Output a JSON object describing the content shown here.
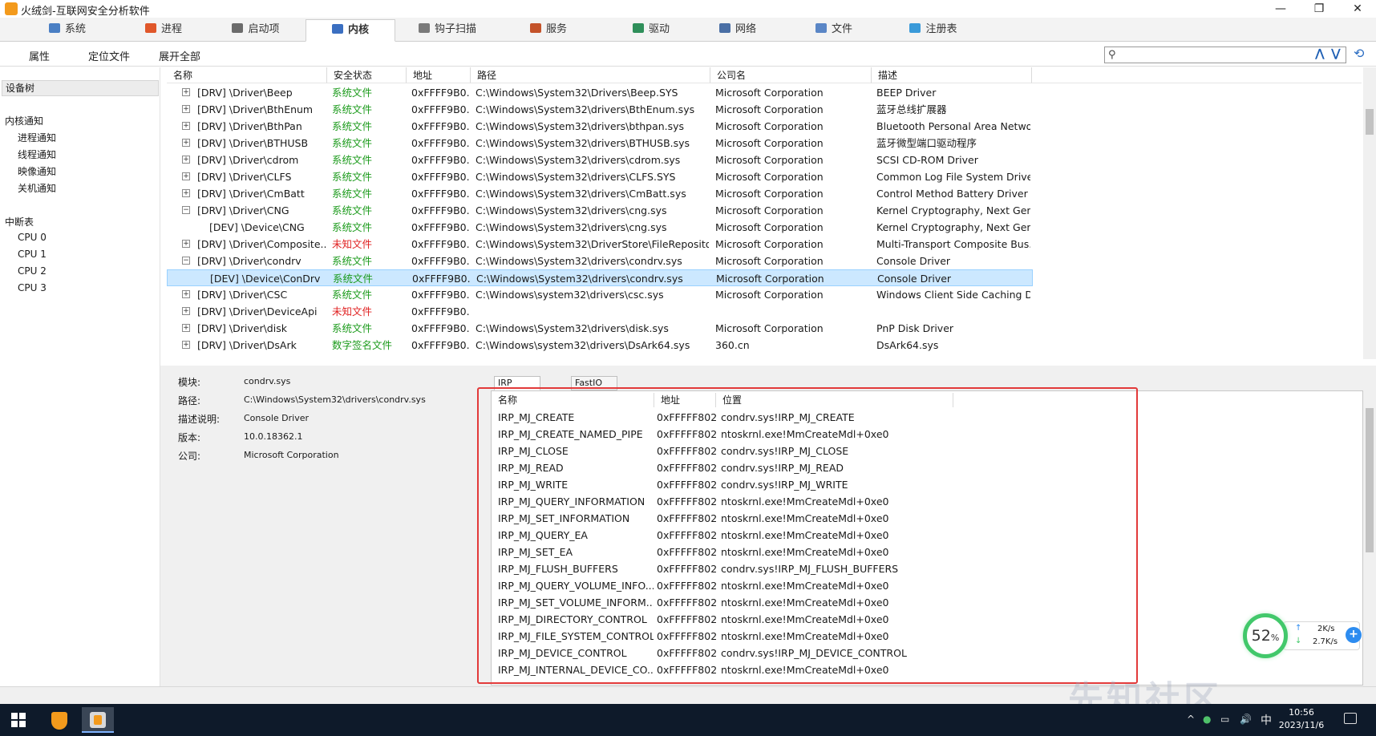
{
  "window": {
    "title": "火绒剑-互联网安全分析软件",
    "controls": {
      "minimize": "—",
      "maximize": "❐",
      "close": "✕"
    }
  },
  "main_tabs": [
    {
      "label": "系统",
      "icon": "monitor-icon",
      "color": "#4a7fc4"
    },
    {
      "label": "进程",
      "icon": "windows-flag-icon",
      "color": "#e0572a"
    },
    {
      "label": "启动项",
      "icon": "gear-icon",
      "color": "#6b6b6b"
    },
    {
      "label": "内核",
      "icon": "pen-icon",
      "color": "#3b6fc1"
    },
    {
      "label": "钩子扫描",
      "icon": "hook-icon",
      "color": "#7a7a7a"
    },
    {
      "label": "服务",
      "icon": "service-icon",
      "color": "#c4532a"
    },
    {
      "label": "驱动",
      "icon": "driver-icon",
      "color": "#2f8f5a"
    },
    {
      "label": "网络",
      "icon": "network-icon",
      "color": "#4a6fa5"
    },
    {
      "label": "文件",
      "icon": "file-icon",
      "color": "#5a86c6"
    },
    {
      "label": "注册表",
      "icon": "registry-icon",
      "color": "#3a9ad9"
    }
  ],
  "toolbar": {
    "properties": "属性",
    "locate_file": "定位文件",
    "expand_all": "展开全部",
    "search_value": ""
  },
  "left_panel": {
    "device_tree": "设备树",
    "kernel_notify": "内核通知",
    "notify_items": [
      "进程通知",
      "线程通知",
      "映像通知",
      "关机通知"
    ],
    "interrupt_table": "中断表",
    "cpu_items": [
      "CPU 0",
      "CPU 1",
      "CPU 2",
      "CPU 3"
    ]
  },
  "grid": {
    "columns": [
      "名称",
      "安全状态",
      "地址",
      "路径",
      "公司名",
      "描述"
    ],
    "rows": [
      {
        "exp": "+",
        "dev": false,
        "name": "[DRV] \\Driver\\Beep",
        "status": "系统文件",
        "st": "sys",
        "addr": "0xFFFF9B0...",
        "path": "C:\\Windows\\System32\\Drivers\\Beep.SYS",
        "company": "Microsoft Corporation",
        "desc": "BEEP Driver"
      },
      {
        "exp": "+",
        "dev": false,
        "name": "[DRV] \\Driver\\BthEnum",
        "status": "系统文件",
        "st": "sys",
        "addr": "0xFFFF9B0...",
        "path": "C:\\Windows\\System32\\drivers\\BthEnum.sys",
        "company": "Microsoft Corporation",
        "desc": "蓝牙总线扩展器"
      },
      {
        "exp": "+",
        "dev": false,
        "name": "[DRV] \\Driver\\BthPan",
        "status": "系统文件",
        "st": "sys",
        "addr": "0xFFFF9B0...",
        "path": "C:\\Windows\\System32\\drivers\\bthpan.sys",
        "company": "Microsoft Corporation",
        "desc": "Bluetooth Personal Area Netwo..."
      },
      {
        "exp": "+",
        "dev": false,
        "name": "[DRV] \\Driver\\BTHUSB",
        "status": "系统文件",
        "st": "sys",
        "addr": "0xFFFF9B0...",
        "path": "C:\\Windows\\System32\\drivers\\BTHUSB.sys",
        "company": "Microsoft Corporation",
        "desc": "蓝牙微型端口驱动程序"
      },
      {
        "exp": "+",
        "dev": false,
        "name": "[DRV] \\Driver\\cdrom",
        "status": "系统文件",
        "st": "sys",
        "addr": "0xFFFF9B0...",
        "path": "C:\\Windows\\System32\\drivers\\cdrom.sys",
        "company": "Microsoft Corporation",
        "desc": "SCSI CD-ROM Driver"
      },
      {
        "exp": "+",
        "dev": false,
        "name": "[DRV] \\Driver\\CLFS",
        "status": "系统文件",
        "st": "sys",
        "addr": "0xFFFF9B0...",
        "path": "C:\\Windows\\System32\\drivers\\CLFS.SYS",
        "company": "Microsoft Corporation",
        "desc": "Common Log File System Driver"
      },
      {
        "exp": "+",
        "dev": false,
        "name": "[DRV] \\Driver\\CmBatt",
        "status": "系统文件",
        "st": "sys",
        "addr": "0xFFFF9B0...",
        "path": "C:\\Windows\\System32\\drivers\\CmBatt.sys",
        "company": "Microsoft Corporation",
        "desc": "Control Method Battery Driver"
      },
      {
        "exp": "−",
        "dev": false,
        "name": "[DRV] \\Driver\\CNG",
        "status": "系统文件",
        "st": "sys",
        "addr": "0xFFFF9B0...",
        "path": "C:\\Windows\\System32\\drivers\\cng.sys",
        "company": "Microsoft Corporation",
        "desc": "Kernel Cryptography, Next Gen..."
      },
      {
        "exp": "",
        "dev": true,
        "name": "[DEV] \\Device\\CNG",
        "status": "系统文件",
        "st": "sys",
        "addr": "0xFFFF9B0...",
        "path": "C:\\Windows\\System32\\drivers\\cng.sys",
        "company": "Microsoft Corporation",
        "desc": "Kernel Cryptography, Next Gen..."
      },
      {
        "exp": "+",
        "dev": false,
        "name": "[DRV] \\Driver\\Composite...",
        "status": "未知文件",
        "st": "unk",
        "addr": "0xFFFF9B0...",
        "path": "C:\\Windows\\System32\\DriverStore\\FileRepositor...",
        "company": "Microsoft Corporation",
        "desc": "Multi-Transport Composite Bus..."
      },
      {
        "exp": "−",
        "dev": false,
        "name": "[DRV] \\Driver\\condrv",
        "status": "系统文件",
        "st": "sys",
        "addr": "0xFFFF9B0...",
        "path": "C:\\Windows\\System32\\drivers\\condrv.sys",
        "company": "Microsoft Corporation",
        "desc": "Console Driver"
      },
      {
        "exp": "",
        "dev": true,
        "name": "[DEV] \\Device\\ConDrv",
        "status": "系统文件",
        "st": "sys",
        "addr": "0xFFFF9B0...",
        "path": "C:\\Windows\\System32\\drivers\\condrv.sys",
        "company": "Microsoft Corporation",
        "desc": "Console Driver",
        "selected": true
      },
      {
        "exp": "+",
        "dev": false,
        "name": "[DRV] \\Driver\\CSC",
        "status": "系统文件",
        "st": "sys",
        "addr": "0xFFFF9B0...",
        "path": "C:\\Windows\\system32\\drivers\\csc.sys",
        "company": "Microsoft Corporation",
        "desc": "Windows Client Side Caching Dr..."
      },
      {
        "exp": "+",
        "dev": false,
        "name": "[DRV] \\Driver\\DeviceApi",
        "status": "未知文件",
        "st": "unk",
        "addr": "0xFFFF9B0...",
        "path": "",
        "company": "",
        "desc": ""
      },
      {
        "exp": "+",
        "dev": false,
        "name": "[DRV] \\Driver\\disk",
        "status": "系统文件",
        "st": "sys",
        "addr": "0xFFFF9B0...",
        "path": "C:\\Windows\\System32\\drivers\\disk.sys",
        "company": "Microsoft Corporation",
        "desc": "PnP Disk Driver"
      },
      {
        "exp": "+",
        "dev": false,
        "name": "[DRV] \\Driver\\DsArk",
        "status": "数字签名文件",
        "st": "sys",
        "addr": "0xFFFF9B0...",
        "path": "C:\\Windows\\system32\\drivers\\DsArk64.sys",
        "company": "360.cn",
        "desc": "DsArk64.sys"
      }
    ]
  },
  "details": {
    "labels": [
      "模块:",
      "路径:",
      "描述说明:",
      "版本:",
      "公司:"
    ],
    "values": [
      "condrv.sys",
      "C:\\Windows\\System32\\drivers\\condrv.sys",
      "Console Driver",
      "10.0.18362.1",
      "Microsoft Corporation"
    ]
  },
  "dispatch_tabs": [
    "IRP Dispatch",
    "FastIO Dispatch"
  ],
  "irp_table": {
    "columns": [
      "名称",
      "地址",
      "位置"
    ],
    "rows": [
      [
        "IRP_MJ_CREATE",
        "0xFFFFF802...",
        "condrv.sys!IRP_MJ_CREATE"
      ],
      [
        "IRP_MJ_CREATE_NAMED_PIPE",
        "0xFFFFF802...",
        "ntoskrnl.exe!MmCreateMdl+0xe0"
      ],
      [
        "IRP_MJ_CLOSE",
        "0xFFFFF802...",
        "condrv.sys!IRP_MJ_CLOSE"
      ],
      [
        "IRP_MJ_READ",
        "0xFFFFF802...",
        "condrv.sys!IRP_MJ_READ"
      ],
      [
        "IRP_MJ_WRITE",
        "0xFFFFF802...",
        "condrv.sys!IRP_MJ_WRITE"
      ],
      [
        "IRP_MJ_QUERY_INFORMATION",
        "0xFFFFF802...",
        "ntoskrnl.exe!MmCreateMdl+0xe0"
      ],
      [
        "IRP_MJ_SET_INFORMATION",
        "0xFFFFF802...",
        "ntoskrnl.exe!MmCreateMdl+0xe0"
      ],
      [
        "IRP_MJ_QUERY_EA",
        "0xFFFFF802...",
        "ntoskrnl.exe!MmCreateMdl+0xe0"
      ],
      [
        "IRP_MJ_SET_EA",
        "0xFFFFF802...",
        "ntoskrnl.exe!MmCreateMdl+0xe0"
      ],
      [
        "IRP_MJ_FLUSH_BUFFERS",
        "0xFFFFF802...",
        "condrv.sys!IRP_MJ_FLUSH_BUFFERS"
      ],
      [
        "IRP_MJ_QUERY_VOLUME_INFO...",
        "0xFFFFF802...",
        "ntoskrnl.exe!MmCreateMdl+0xe0"
      ],
      [
        "IRP_MJ_SET_VOLUME_INFORM...",
        "0xFFFFF802...",
        "ntoskrnl.exe!MmCreateMdl+0xe0"
      ],
      [
        "IRP_MJ_DIRECTORY_CONTROL",
        "0xFFFFF802...",
        "ntoskrnl.exe!MmCreateMdl+0xe0"
      ],
      [
        "IRP_MJ_FILE_SYSTEM_CONTROL",
        "0xFFFFF802...",
        "ntoskrnl.exe!MmCreateMdl+0xe0"
      ],
      [
        "IRP_MJ_DEVICE_CONTROL",
        "0xFFFFF802...",
        "condrv.sys!IRP_MJ_DEVICE_CONTROL"
      ],
      [
        "IRP_MJ_INTERNAL_DEVICE_CO...",
        "0xFFFFF802...",
        "ntoskrnl.exe!MmCreateMdl+0xe0"
      ]
    ]
  },
  "net_widget": {
    "percent": "52",
    "percent_sign": "%",
    "upload": "2K/s",
    "download": "2.7K/s",
    "up_arrow": "↑",
    "down_arrow": "↓",
    "plus": "+"
  },
  "taskbar": {
    "time": "10:56",
    "date": "2023/11/6",
    "ime": "中",
    "tray": [
      "^",
      "●",
      "▭",
      "🔊"
    ]
  },
  "watermark": "先知社区",
  "colors": {
    "accent": "#2d8cf0",
    "system_file": "#1a9a1a",
    "unknown_file": "#e02020",
    "highlight_box": "#e23a3a",
    "selected_row": "#cce8ff"
  }
}
